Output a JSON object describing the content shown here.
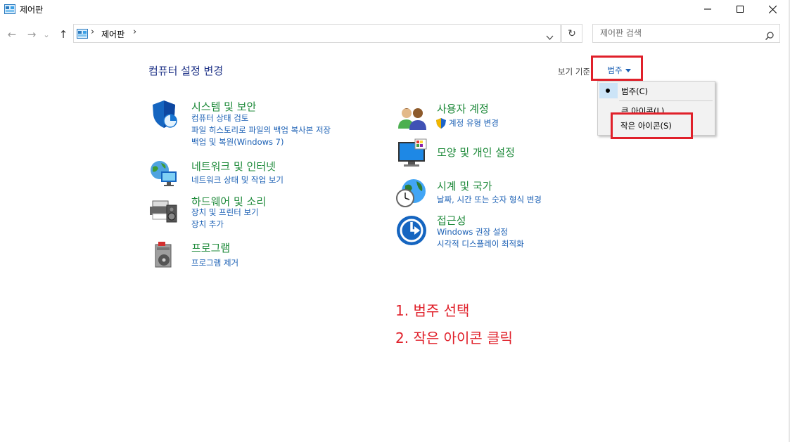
{
  "window": {
    "title": "제어판",
    "minimize_glyph": "—",
    "maximize_glyph": "☐",
    "close_glyph": "✕"
  },
  "nav": {
    "back_glyph": "←",
    "forward_glyph": "→",
    "recent_glyph": "⌄",
    "up_glyph": "↑",
    "breadcrumb_sep": "›",
    "breadcrumb_item": "제어판",
    "breadcrumb_trailing_sep": "›",
    "refresh_glyph": "↻"
  },
  "search": {
    "placeholder": "제어판 검색"
  },
  "main": {
    "heading": "컴퓨터 설정 변경",
    "view_by_label": "보기 기준:",
    "view_by_value": "범주"
  },
  "view_menu": {
    "items": [
      {
        "label": "범주(C)",
        "selected": true
      },
      {
        "label": "큰 아이콘(L)",
        "selected": false
      },
      {
        "label": "작은 아이콘(S)",
        "selected": false
      }
    ]
  },
  "categories": [
    {
      "title": "시스템 및 보안",
      "icon": "shield-icon",
      "links": [
        "컴퓨터 상태 검토",
        "파일 히스토리로 파일의 백업 복사본 저장",
        "백업 및 복원(Windows 7)"
      ]
    },
    {
      "title": "네트워크 및 인터넷",
      "icon": "network-globe-icon",
      "links": [
        "네트워크 상태 및 작업 보기"
      ]
    },
    {
      "title": "하드웨어 및 소리",
      "icon": "printer-speaker-icon",
      "links": [
        "장치 및 프린터 보기",
        "장치 추가"
      ]
    },
    {
      "title": "프로그램",
      "icon": "programs-disc-icon",
      "links": [
        "프로그램 제거"
      ]
    },
    {
      "title": "사용자 계정",
      "icon": "users-icon",
      "links": [
        "계정 유형 변경"
      ]
    },
    {
      "title": "모양 및 개인 설정",
      "icon": "monitor-palette-icon",
      "links": []
    },
    {
      "title": "시계 및 국가",
      "icon": "clock-globe-icon",
      "links": [
        "날짜, 시간 또는 숫자 형식 변경"
      ]
    },
    {
      "title": "접근성",
      "icon": "accessibility-icon",
      "links": [
        "Windows 권장 설정",
        "시각적 디스플레이 최적화"
      ]
    }
  ],
  "annotations": [
    "1. 범주 선택",
    "2. 작은 아이콘 클릭"
  ],
  "colors": {
    "heading": "#1e3287",
    "category_title": "#1e8a3a",
    "link": "#1a5fb4",
    "annotation_red": "#e0202a"
  }
}
